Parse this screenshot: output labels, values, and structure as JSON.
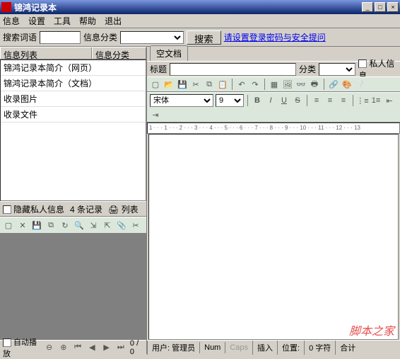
{
  "window": {
    "title": "锦鸿记录本"
  },
  "menu": {
    "info": "信息",
    "config": "设置",
    "tools": "工具",
    "help": "帮助",
    "exit": "退出"
  },
  "search": {
    "term_label": "搜索词语",
    "category_label": "信息分类",
    "button": "搜索",
    "link": "请设置登录密码与安全提问"
  },
  "list": {
    "col1": "信息列表",
    "col2": "信息分类",
    "rows": [
      "锦鸿记录本简介（网页）",
      "锦鸿记录本简介（文档）",
      "收录图片",
      "收录文件"
    ]
  },
  "leftbar": {
    "hide": "隐藏私人信息",
    "count": "4 条记录",
    "listbtn": "列表"
  },
  "pager": {
    "auto": "自动播放",
    "pos": "0 / 0"
  },
  "tab": {
    "empty": "空文档"
  },
  "doc": {
    "title_label": "标题",
    "category_label": "分类",
    "private": "私人信息"
  },
  "editor": {
    "font": "宋体",
    "size": "9"
  },
  "ruler": "1 · · · 1 · · · 2 · · · 3 · · · 4 · · · 5 · · · 6 · · · 7 · · · 8 · · · 9 · · · 10 · · · 11 · · · 12 · · · 13",
  "status": {
    "user_label": "用户:",
    "user": "管理员",
    "num": "Num",
    "caps": "Caps",
    "insert": "插入",
    "pos": "位置:",
    "chars": "0 字符",
    "total": "合计"
  },
  "watermark": "脚本之家"
}
